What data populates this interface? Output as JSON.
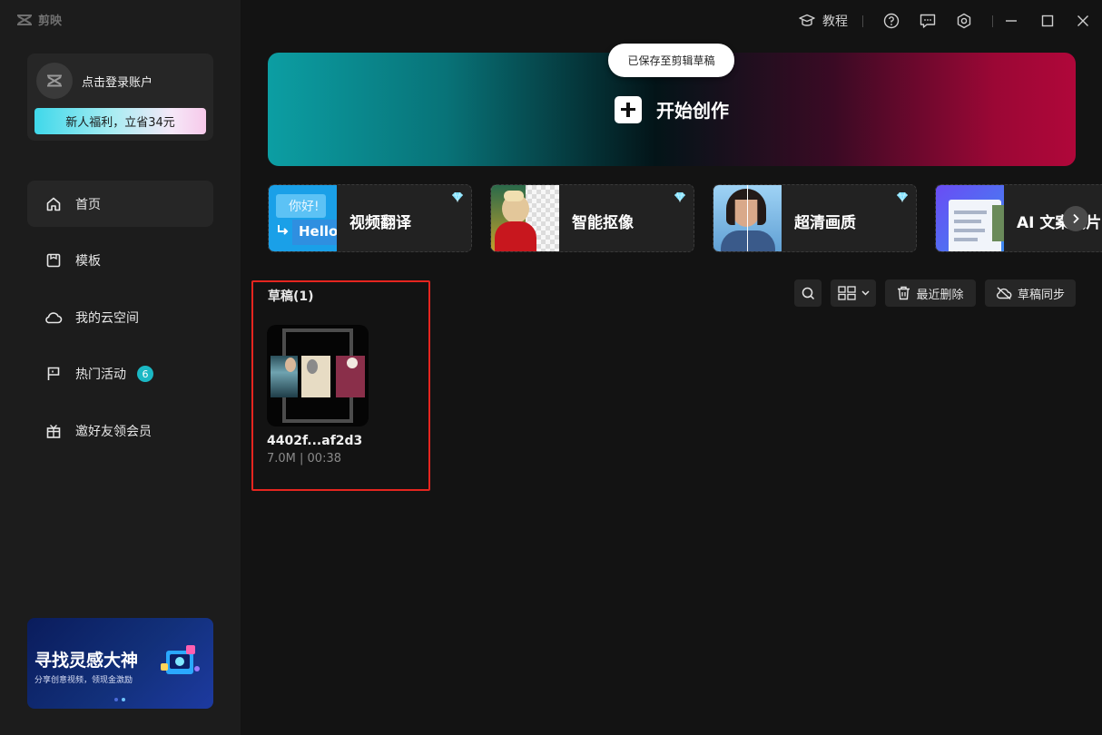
{
  "app": {
    "title": "剪映"
  },
  "account": {
    "login_text": "点击登录账户",
    "promo": "新人福利，立省34元"
  },
  "nav": [
    {
      "label": "首页",
      "icon": "home-icon",
      "active": true
    },
    {
      "label": "模板",
      "icon": "template-icon"
    },
    {
      "label": "我的云空间",
      "icon": "cloud-icon"
    },
    {
      "label": "热门活动",
      "icon": "flag-icon",
      "badge": "6"
    },
    {
      "label": "邀好友领会员",
      "icon": "gift-icon"
    }
  ],
  "banner": {
    "title": "寻找灵感大神",
    "subtitle": "分享创意视频，领现金激励"
  },
  "topbar": {
    "tutorial": "教程"
  },
  "hero": {
    "label": "开始创作"
  },
  "toast": "已保存至剪辑草稿",
  "features": [
    {
      "label": "视频翻译",
      "thumb_text_1": "你好!",
      "thumb_text_2": "Hello"
    },
    {
      "label": "智能抠像"
    },
    {
      "label": "超清画质"
    },
    {
      "label": "AI 文案成片"
    }
  ],
  "drafts": {
    "title": "草稿(1)",
    "recent_delete": "最近删除",
    "sync": "草稿同步",
    "items": [
      {
        "name": "4402f...af2d3",
        "meta": "7.0M | 00:38"
      }
    ]
  },
  "colors": {
    "accent": "#1bb8c4",
    "highlight": "#e5251f"
  }
}
